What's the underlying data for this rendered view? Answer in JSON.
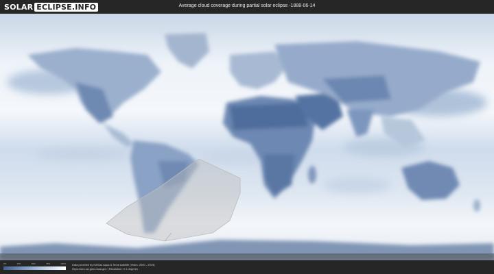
{
  "header": {
    "logo_left": "SOLAR",
    "logo_right": "ECLIPSE.INFO",
    "title": "Average cloud coverage during partial solar eclipse -1888-06-14"
  },
  "legend": {
    "ticks": [
      "0%",
      "25%",
      "50%",
      "75%",
      "100%"
    ],
    "colors": [
      "#43608f",
      "#7d9bc2",
      "#bfd2e6",
      "#ffffff"
    ]
  },
  "credits": {
    "line1": "Data provided by NASAs Aqua & Terra satellite (Years: 2000 - 2019)",
    "line2": "https://neo.sci.gsfc.nasa.gov | Resolution: 0.1 degrees"
  }
}
